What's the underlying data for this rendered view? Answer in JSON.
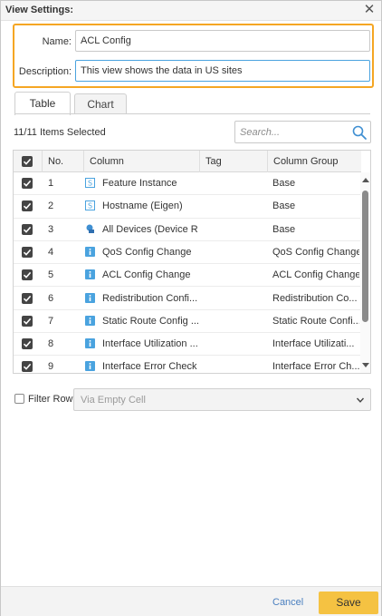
{
  "dialog": {
    "title": "View Settings:"
  },
  "form": {
    "name_label": "Name:",
    "name_value": "ACL Config",
    "description_label": "Description:",
    "description_value": "This view shows the data in US sites"
  },
  "tabs": [
    {
      "label": "Table",
      "active": true
    },
    {
      "label": "Chart",
      "active": false
    }
  ],
  "selection": {
    "count_text": "11/11 Items Selected"
  },
  "search": {
    "placeholder": "Search..."
  },
  "grid": {
    "headers": {
      "no": "No.",
      "column": "Column",
      "tag": "Tag",
      "group": "Column Group"
    },
    "rows": [
      {
        "no": "1",
        "column": "Feature Instance",
        "tag": "",
        "group": "Base",
        "icon": "s-icon",
        "checked": true
      },
      {
        "no": "2",
        "column": "Hostname (Eigen)",
        "tag": "",
        "group": "Base",
        "icon": "s-icon",
        "checked": true
      },
      {
        "no": "3",
        "column": "All Devices (Device R...",
        "tag": "",
        "group": "Base",
        "icon": "device-icon",
        "checked": true
      },
      {
        "no": "4",
        "column": "QoS Config Change",
        "tag": "",
        "group": "QoS Config Change",
        "icon": "info-icon",
        "checked": true
      },
      {
        "no": "5",
        "column": "ACL Config Change",
        "tag": "",
        "group": "ACL Config Change",
        "icon": "info-icon",
        "checked": true
      },
      {
        "no": "6",
        "column": "Redistribution Confi...",
        "tag": "",
        "group": "Redistribution Co...",
        "icon": "info-icon",
        "checked": true
      },
      {
        "no": "7",
        "column": "Static Route Config ...",
        "tag": "",
        "group": "Static Route Confi...",
        "icon": "info-icon",
        "checked": true
      },
      {
        "no": "8",
        "column": "Interface Utilization ...",
        "tag": "",
        "group": "Interface Utilizati...",
        "icon": "info-icon",
        "checked": true
      },
      {
        "no": "9",
        "column": "Interface Error Check",
        "tag": "",
        "group": "Interface Error Ch...",
        "icon": "info-icon",
        "checked": true
      }
    ]
  },
  "filter": {
    "label": "Filter Row",
    "value": "Via Empty Cell"
  },
  "footer": {
    "cancel_label": "Cancel",
    "save_label": "Save"
  },
  "colors": {
    "accent_border": "#f5a623",
    "save_button": "#f5c242",
    "icon_blue": "#4aa3df",
    "link": "#4a7fbf"
  }
}
